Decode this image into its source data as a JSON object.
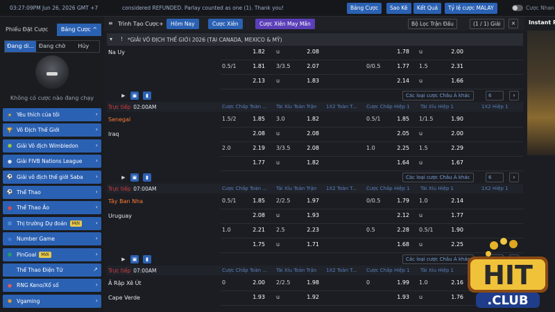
{
  "topbar": {
    "clock": "03:27:09PM Jun 26, 2026 GMT +7",
    "ticker": "considered REFUNDED. Parlay counted as one (1). Thank you!",
    "buttons": [
      "Bảng Cược",
      "Sao Kê",
      "Kết Quả",
      "Tỷ lệ cược MALAY"
    ],
    "toggle_label": "Cược Nhan"
  },
  "sidebar": {
    "slip_tab": "Phiếu Đặt Cược",
    "history_tab": "Bảng Cược",
    "subtabs": [
      "Đang di...",
      "Đang chờ",
      "Hủy"
    ],
    "no_bets": "Không có cược nào đang chạy",
    "menu": [
      {
        "label": "Yêu thích của tôi",
        "icon": "star-icon",
        "color": "#f0b51c",
        "glyph": "★"
      },
      {
        "label": "Vô Địch Thế Giới",
        "icon": "trophy-icon",
        "color": "#f0b51c",
        "glyph": "🏆"
      },
      {
        "label": "Giải Vô địch Wimbledon",
        "icon": "tennis-icon",
        "color": "#9ec93c",
        "glyph": "●"
      },
      {
        "label": "Giải FIVB Nations League",
        "icon": "volleyball-icon",
        "color": "#e3e6eb",
        "glyph": "●"
      },
      {
        "label": "Giải vô địch thế giới Saba",
        "icon": "soccer-icon",
        "color": "#e3e6eb",
        "glyph": "⚽"
      },
      {
        "label": "Thể Thao",
        "icon": "sports-icon",
        "color": "#e3e6eb",
        "glyph": "⚽"
      },
      {
        "label": "Thể Thao Ảo",
        "icon": "virtual-sports-icon",
        "color": "#d94a4a",
        "glyph": "●"
      },
      {
        "label": "Thị trường Dự đoán",
        "icon": "prediction-icon",
        "color": "#4a8ad9",
        "glyph": "■",
        "badge": "Mới"
      },
      {
        "label": "Number Game",
        "icon": "number-game-icon",
        "color": "#3c7ad9",
        "glyph": "●"
      },
      {
        "label": "PinGoal",
        "icon": "pingoal-icon",
        "color": "#27a05a",
        "glyph": "●",
        "badge": "Mới"
      },
      {
        "label": "Thể Thao Điện Tử",
        "icon": "esports-icon",
        "color": "#2b61b3",
        "glyph": "●",
        "external": "↗"
      },
      {
        "label": "RNG Keno/Xổ số",
        "icon": "keno-icon",
        "color": "#e35a5a",
        "glyph": "●"
      },
      {
        "label": "Vgaming",
        "icon": "vgaming-icon",
        "color": "#d79b3a",
        "glyph": "●"
      }
    ],
    "arrow": "›"
  },
  "toolbar": {
    "title": "Trình Tạo Cược+",
    "chips": [
      "Hôm Nay",
      "Cược Xiên",
      "Cược Xiên May Mắn"
    ],
    "filter": "Bộ Lọc Trận Đấu",
    "pages": "(1 / 1) Giải",
    "icons": [
      "×",
      "⊞",
      "▲"
    ]
  },
  "league": {
    "name": "*GIẢI VÔ ĐỊCH THẾ GIỚI 2026 (TẠI CANADA, MEXICO & MỸ)"
  },
  "columns": [
    "Cược Chấp Toàn ...",
    "Tài Xỉu Toàn Trận",
    "1X2 Toàn T...",
    "Cược Chấp Hiệp 1",
    "Tài Xỉu Hiệp 1",
    "1X2 Hiệp 1"
  ],
  "live_label": "Trực tiếp",
  "market_more": "Các loại cược Châu Á khác",
  "market_count": "6",
  "match0": {
    "team": "Na Uy",
    "rows": [
      [
        "",
        "1.82",
        "u",
        "2.08",
        "",
        "1.78",
        "u",
        "2.00"
      ],
      [
        "0.5/1",
        "1.81",
        "3/3.5",
        "2.07",
        "0/0.5",
        "1.77",
        "1.5",
        "2.31"
      ],
      [
        "",
        "2.13",
        "u",
        "1.83",
        "",
        "2.14",
        "u",
        "1.66"
      ]
    ]
  },
  "matches": [
    {
      "time": "02:00AM",
      "home": "Senegal",
      "away": "Iraq",
      "rows": [
        [
          "1.5/2",
          "1.85",
          "3.0",
          "1.82",
          "0.5/1",
          "1.85",
          "1/1.5",
          "1.90"
        ],
        [
          "",
          "2.08",
          "u",
          "2.08",
          "",
          "2.05",
          "u",
          "2.00"
        ],
        [
          "2.0",
          "2.19",
          "3/3.5",
          "2.08",
          "1.0",
          "2.25",
          "1.5",
          "2.29"
        ],
        [
          "",
          "1.77",
          "u",
          "1.82",
          "",
          "1.64",
          "u",
          "1.67"
        ]
      ]
    },
    {
      "time": "07:00AM",
      "home": "Tây Ban Nha",
      "away": "Uruguay",
      "rows": [
        [
          "0.5/1",
          "1.85",
          "2/2.5",
          "1.97",
          "0/0.5",
          "1.79",
          "1.0",
          "2.14"
        ],
        [
          "",
          "2.08",
          "u",
          "1.93",
          "",
          "2.12",
          "u",
          "1.77"
        ],
        [
          "1.0",
          "2.21",
          "2.5",
          "2.23",
          "0.5",
          "2.28",
          "0.5/1",
          "1.90"
        ],
        [
          "",
          "1.75",
          "u",
          "1.71",
          "",
          "1.68",
          "u",
          "2.25"
        ]
      ]
    },
    {
      "time": "07:00AM",
      "home": "Ả Rập Xê Út",
      "away": "Cape Verde",
      "rows": [
        [
          "0",
          "2.00",
          "2/2.5",
          "1.98",
          "0",
          "1.99",
          "1.0",
          "2.16"
        ],
        [
          "",
          "1.93",
          "u",
          "1.92",
          "",
          "1.93",
          "u",
          "1.76"
        ]
      ]
    }
  ],
  "right": {
    "title": "Instant P",
    "logo_text": "HIT",
    "logo_sub": ".CLUB"
  },
  "colors": {
    "accent": "#2b61b3",
    "favorite": "#ff7a36",
    "live": "#d43c3c",
    "column_header": "#5a80be"
  }
}
